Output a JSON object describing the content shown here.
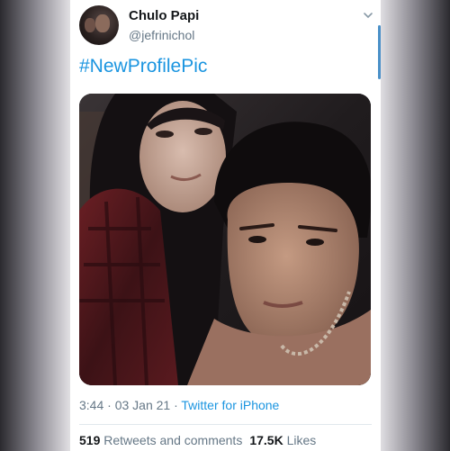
{
  "tweet": {
    "display_name": "Chulo Papi",
    "handle": "@jefrinichol",
    "text": "#NewProfilePic",
    "time": "3:44",
    "separator": "·",
    "date": "03 Jan 21",
    "source_separator": "·",
    "source": "Twitter for iPhone"
  },
  "stats": {
    "retweets_count": "519",
    "retweets_label": "Retweets and comments",
    "likes_count": "17.5K",
    "likes_label": "Likes"
  },
  "colors": {
    "link": "#1b95e0",
    "text_primary": "#14171a",
    "text_secondary": "#657786"
  },
  "icons": {
    "menu": "chevron-down-icon"
  }
}
